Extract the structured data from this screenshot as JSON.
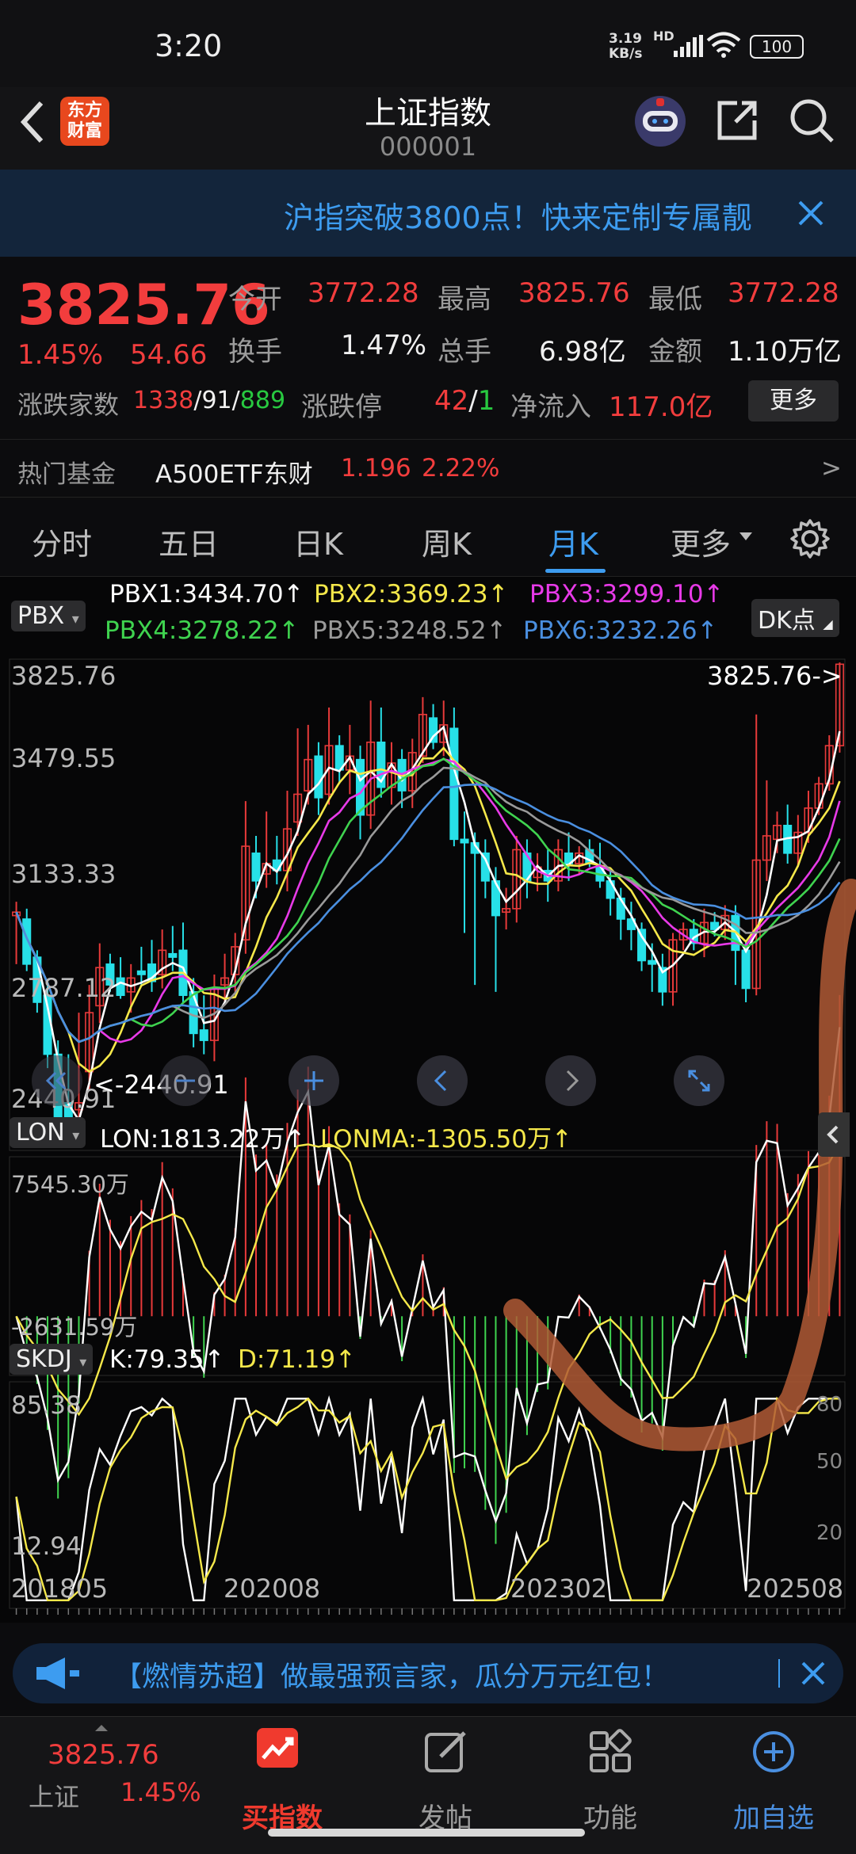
{
  "status": {
    "time": "3:20",
    "speed": "3.19",
    "speed_unit": "KB/s",
    "hd": "HD",
    "battery": "100"
  },
  "header": {
    "title": "上证指数",
    "code": "000001",
    "logo_line1": "东方",
    "logo_line2": "财富"
  },
  "banner": {
    "text": "沪指突破3800点！快来定制专属靓"
  },
  "quote": {
    "price": "3825.76",
    "change_pct": "1.45%",
    "change": "54.66",
    "open_label": "今开",
    "open": "3772.28",
    "high_label": "最高",
    "high": "3825.76",
    "low_label": "最低",
    "low": "3772.28",
    "turnover_label": "换手",
    "turnover": "1.47%",
    "volume_label": "总手",
    "volume": "6.98亿",
    "amount_label": "金额",
    "amount": "1.10万亿",
    "breadth_label": "涨跌家数",
    "up": "1338",
    "flat": "91",
    "down": "889",
    "limit_label": "涨跌停",
    "limit_up": "42",
    "limit_down": "1",
    "netflow_label": "净流入",
    "netflow": "117.0亿",
    "more_button": "更多"
  },
  "fund": {
    "label": "热门基金",
    "name": "A500ETF东财",
    "price": "1.196",
    "pct": "2.22%",
    "arrow": ">"
  },
  "tabs": [
    {
      "label": "分时",
      "active": false
    },
    {
      "label": "五日",
      "active": false
    },
    {
      "label": "日K",
      "active": false
    },
    {
      "label": "周K",
      "active": false
    },
    {
      "label": "月K",
      "active": true
    },
    {
      "label": "更多",
      "active": false
    }
  ],
  "indicator_main": {
    "selector": "PBX",
    "dk_button": "DK点",
    "pbx1": "PBX1:3434.70↑",
    "pbx2": "PBX2:3369.23↑",
    "pbx3": "PBX3:3299.10↑",
    "pbx4": "PBX4:3278.22↑",
    "pbx5": "PBX5:3248.52↑",
    "pbx6": "PBX6:3232.26↑",
    "colors": {
      "pbx1": "#ffffff",
      "pbx2": "#f5e84a",
      "pbx3": "#e83ae8",
      "pbx4": "#3fd34f",
      "pbx5": "#9a9a9a",
      "pbx6": "#4a8fe0",
      "up": "#e83a3a",
      "down": "#27e0e8"
    }
  },
  "price_axis": {
    "top": "3825.76",
    "l2": "3479.55",
    "l3": "3133.33",
    "l4": "2787.12",
    "bottom": "2440.91",
    "max_marker": "3825.76->",
    "min_marker": "<-2440.91"
  },
  "indicator_lon": {
    "selector": "LON",
    "lon": "LON:1813.22万↑",
    "lonma": "LONMA:-1305.50万↑",
    "top": "7545.30万",
    "bottom": "-2631.59万"
  },
  "indicator_skdj": {
    "selector": "SKDJ",
    "k": "K:79.35↑",
    "d": "D:71.19↑",
    "top": "85.38",
    "bottom": "12.94",
    "r80": "80",
    "r50": "50",
    "r20": "20"
  },
  "time_axis": {
    "t1": "201805",
    "t2": "202008",
    "t3": "202302",
    "t4": "202508"
  },
  "promo": {
    "text": "【燃情苏超】做最强预言家，瓜分万元红包！"
  },
  "bottom_nav": {
    "price": "3825.76",
    "index_name": "上证",
    "pct": "1.45%",
    "buy_label": "买指数",
    "post_label": "发帖",
    "func_label": "功能",
    "add_label": "加自选"
  },
  "chart_data": {
    "type": "candlestick",
    "period": "monthly",
    "x_ticks": [
      "201805",
      "202008",
      "202302",
      "202508"
    ],
    "y_ticks": [
      3825.76,
      3479.55,
      3133.33,
      2787.12,
      2440.91
    ],
    "ylim": [
      2440.91,
      3825.76
    ],
    "last_close": 3825.76,
    "period_min": 2440.91,
    "ma_series": [
      {
        "name": "PBX1",
        "value": 3434.7
      },
      {
        "name": "PBX2",
        "value": 3369.23
      },
      {
        "name": "PBX3",
        "value": 3299.1
      },
      {
        "name": "PBX4",
        "value": 3278.22
      },
      {
        "name": "PBX5",
        "value": 3248.52
      },
      {
        "name": "PBX6",
        "value": 3232.26
      }
    ],
    "lon": {
      "LON": 1813.22,
      "LONMA": -1305.5,
      "unit": "万",
      "ylim": [
        -2631.59,
        7545.3
      ]
    },
    "skdj": {
      "K": 79.35,
      "D": 71.19,
      "ylim": [
        12.94,
        85.38
      ]
    },
    "candles": [
      [
        3100,
        3110,
        2990,
        3140,
        2960
      ],
      [
        3090,
        2960,
        3060,
        3120,
        2940
      ],
      [
        2980,
        2850,
        2950,
        3000,
        2820
      ],
      [
        2870,
        2700,
        2860,
        2900,
        2660
      ],
      [
        2700,
        2500,
        2690,
        2740,
        2460
      ],
      [
        2560,
        2470,
        2650,
        2700,
        2440
      ],
      [
        2540,
        2560,
        2460,
        2820,
        2450
      ],
      [
        2650,
        2820,
        2620,
        2900,
        2600
      ],
      [
        2840,
        2950,
        2830,
        3020,
        2790
      ],
      [
        2960,
        2900,
        2970,
        2990,
        2880
      ],
      [
        2920,
        2870,
        2950,
        2980,
        2860
      ],
      [
        2880,
        2920,
        2860,
        2960,
        2820
      ],
      [
        2940,
        2930,
        2980,
        3010,
        2900
      ],
      [
        2960,
        2910,
        2990,
        3030,
        2880
      ],
      [
        2930,
        3000,
        2920,
        3060,
        2890
      ],
      [
        2990,
        2980,
        3030,
        3070,
        2940
      ],
      [
        3000,
        2870,
        3020,
        3080,
        2850
      ],
      [
        2880,
        2760,
        2900,
        2920,
        2720
      ],
      [
        2770,
        2740,
        2800,
        2870,
        2700
      ],
      [
        2740,
        2890,
        2710,
        2930,
        2680
      ],
      [
        2900,
        2920,
        2880,
        2990,
        2850
      ],
      [
        2930,
        3010,
        2910,
        3050,
        2880
      ],
      [
        3030,
        3300,
        3010,
        3430,
        2990
      ],
      [
        3280,
        3200,
        3300,
        3330,
        3150
      ],
      [
        3220,
        3250,
        3200,
        3400,
        3180
      ],
      [
        3260,
        3230,
        3290,
        3330,
        3190
      ],
      [
        3230,
        3350,
        3200,
        3460,
        3170
      ],
      [
        3370,
        3450,
        3350,
        3640,
        3330
      ],
      [
        3460,
        3550,
        3440,
        3650,
        3420
      ],
      [
        3560,
        3440,
        3580,
        3600,
        3390
      ],
      [
        3450,
        3590,
        3430,
        3700,
        3420
      ],
      [
        3590,
        3520,
        3600,
        3620,
        3480
      ],
      [
        3520,
        3560,
        3480,
        3650,
        3450
      ],
      [
        3550,
        3390,
        3570,
        3590,
        3320
      ],
      [
        3390,
        3600,
        3370,
        3720,
        3350
      ],
      [
        3600,
        3470,
        3630,
        3700,
        3440
      ],
      [
        3470,
        3540,
        3450,
        3600,
        3420
      ],
      [
        3550,
        3460,
        3570,
        3580,
        3410
      ],
      [
        3460,
        3570,
        3440,
        3610,
        3410
      ],
      [
        3560,
        3680,
        3550,
        3730,
        3540
      ],
      [
        3670,
        3600,
        3680,
        3710,
        3580
      ],
      [
        3600,
        3650,
        3580,
        3720,
        3560
      ],
      [
        3640,
        3320,
        3660,
        3700,
        3300
      ],
      [
        3320,
        3310,
        3350,
        3400,
        3050
      ],
      [
        3310,
        3280,
        3250,
        3340,
        2900
      ],
      [
        3280,
        3200,
        3290,
        3320,
        3150
      ],
      [
        3200,
        3100,
        3210,
        3240,
        2880
      ],
      [
        3110,
        3120,
        3090,
        3180,
        3060
      ],
      [
        3120,
        3290,
        3100,
        3330,
        3080
      ],
      [
        3280,
        3200,
        3300,
        3320,
        3150
      ],
      [
        3210,
        3240,
        3190,
        3280,
        3170
      ],
      [
        3230,
        3200,
        3250,
        3290,
        3140
      ],
      [
        3200,
        3290,
        3190,
        3320,
        3170
      ],
      [
        3280,
        3250,
        3300,
        3340,
        3200
      ],
      [
        3250,
        3280,
        3240,
        3300,
        3220
      ],
      [
        3290,
        3250,
        3300,
        3320,
        3240
      ],
      [
        3240,
        3200,
        3250,
        3310,
        3180
      ],
      [
        3200,
        3150,
        3210,
        3230,
        3100
      ],
      [
        3150,
        3090,
        3160,
        3180,
        3030
      ],
      [
        3090,
        3060,
        3100,
        3140,
        3000
      ],
      [
        3060,
        2970,
        3070,
        3080,
        2940
      ],
      [
        2970,
        2960,
        2990,
        3020,
        2880
      ],
      [
        2950,
        2880,
        2970,
        2990,
        2840
      ],
      [
        2880,
        3030,
        2870,
        3050,
        2840
      ],
      [
        3030,
        3060,
        3020,
        3080,
        3000
      ],
      [
        3060,
        3020,
        3070,
        3090,
        3000
      ],
      [
        3020,
        3080,
        3010,
        3120,
        2980
      ],
      [
        3080,
        3060,
        3090,
        3110,
        3040
      ],
      [
        3060,
        3100,
        3050,
        3130,
        3030
      ],
      [
        3100,
        3000,
        3110,
        3130,
        2900
      ],
      [
        3000,
        2890,
        3010,
        3030,
        2850
      ],
      [
        2890,
        3260,
        2880,
        3680,
        2870
      ],
      [
        3260,
        3330,
        3240,
        3490,
        3200
      ],
      [
        3320,
        3360,
        3300,
        3400,
        3280
      ],
      [
        3360,
        3280,
        3380,
        3420,
        3250
      ],
      [
        3280,
        3340,
        3270,
        3390,
        3240
      ],
      [
        3340,
        3410,
        3330,
        3460,
        3310
      ],
      [
        3410,
        3480,
        3400,
        3500,
        3390
      ],
      [
        3480,
        3590,
        3470,
        3620,
        3460
      ],
      [
        3590,
        3825,
        3580,
        3830,
        3570
      ]
    ]
  }
}
